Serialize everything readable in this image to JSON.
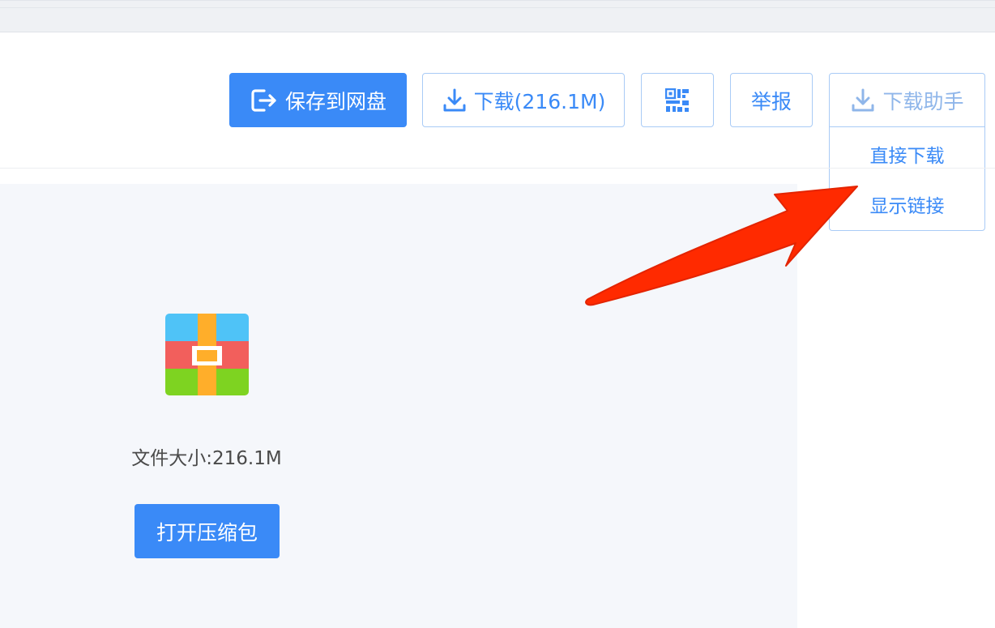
{
  "toolbar": {
    "save_label": "保存到网盘",
    "download_label": "下载(216.1M)",
    "report_label": "举报",
    "helper_label": "下载助手"
  },
  "helper_menu": {
    "items": [
      "直接下载",
      "显示链接"
    ]
  },
  "file": {
    "size_text": "文件大小:216.1M",
    "open_label": "打开压缩包"
  },
  "colors": {
    "accent": "#3a8af7",
    "outline": "#a9cbf6",
    "panel_bg": "#f5f7fb",
    "arrow": "#ff2a00"
  },
  "icons": {
    "save": "export-icon",
    "download": "download-icon",
    "qr": "qr-code-icon",
    "file": "zip-archive-icon"
  }
}
